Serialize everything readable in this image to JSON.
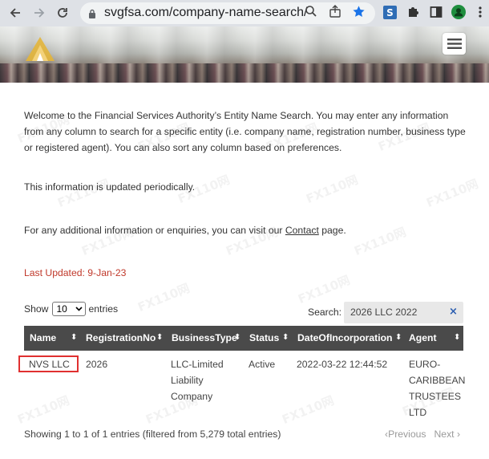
{
  "browser": {
    "url": "svgfsa.com/company-name-search/"
  },
  "welcome_text": "Welcome to the Financial Services Authority’s Entity Name Search. You may enter any information from any column to search for a specific entity (i.e. company name, registration number, business type or registered agent). You can also sort any column based on preferences.",
  "updated_text": "This information is updated periodically.",
  "enquiry": {
    "before": "For any additional information or enquiries, you can visit our ",
    "link": "Contact",
    "after": " page."
  },
  "last_updated": "Last Updated:  9-Jan-23",
  "show": {
    "before": "Show",
    "value": "10",
    "after": "entries"
  },
  "search": {
    "label": "Search:",
    "value": "2026 LLC 2022",
    "clear": "×"
  },
  "table": {
    "headers": [
      "Name",
      "RegistrationNo",
      "BusinessType",
      "Status",
      "DateOfIncorporation",
      "Agent"
    ],
    "row": {
      "name": "NVS LLC",
      "reg_no": "2026",
      "business_type": [
        "LLC-Limited",
        "Liability",
        "Company"
      ],
      "status": "Active",
      "date": "2022-03-22 12:44:52",
      "agent": [
        "EURO-",
        "CARIBBEAN",
        "TRUSTEES",
        "LTD"
      ]
    }
  },
  "info": "Showing 1 to 1 of 1 entries (filtered from 5,279 total entries)",
  "pager": {
    "previous": "Previous",
    "next": "Next"
  },
  "watermark": "FX110网",
  "colors": {
    "header_bg": "#4a4a4a",
    "last_updated": "#c0392b",
    "highlight": "#e03030",
    "bookmark_star": "#1a73e8"
  }
}
